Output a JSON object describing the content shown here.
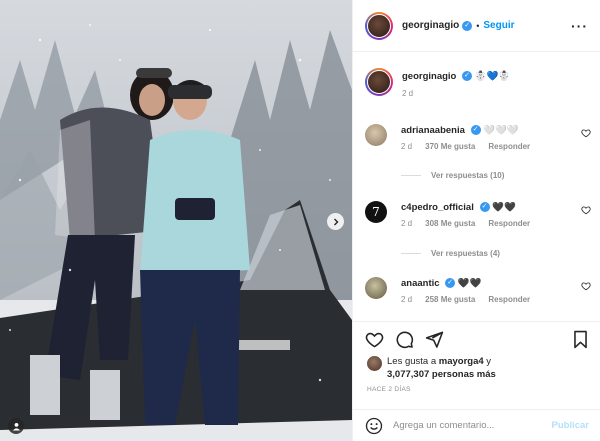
{
  "post": {
    "author": "georginagio",
    "follow_label": "Seguir",
    "separator": "•",
    "more_glyph": "···"
  },
  "caption": {
    "username": "georginagio",
    "text": "☃️💙☃️",
    "time": "2 d"
  },
  "comments": [
    {
      "username": "adrianaabenia",
      "text": "🤍🤍🤍",
      "time": "2 d",
      "likes": "370 Me gusta",
      "reply": "Responder",
      "replies": "Ver respuestas (10)",
      "avatar_color": "#b9a58e"
    },
    {
      "username": "c4pedro_official",
      "text": "🖤🖤",
      "time": "2 d",
      "likes": "308 Me gusta",
      "reply": "Responder",
      "replies": "Ver respuestas (4)",
      "avatar_color": "#111111"
    },
    {
      "username": "anaantic",
      "text": "🖤🖤",
      "time": "2 d",
      "likes": "258 Me gusta",
      "reply": "Responder",
      "avatar_color": "#9a8f6a"
    }
  ],
  "likes": {
    "prefix": "Les gusta a",
    "user": "mayorga4",
    "connector": "y",
    "count": "3,077,307 personas más"
  },
  "timestamp": "HACE 2 DÍAS",
  "add_comment": {
    "placeholder": "Agrega un comentario...",
    "publish_label": "Publicar"
  },
  "colors": {
    "accent": "#0095f6",
    "verified": "#3897f0",
    "muted": "#8e8e8e",
    "publish_disabled": "#b2dffc"
  },
  "icons": [
    "heart-icon",
    "comment-icon",
    "share-icon",
    "bookmark-icon",
    "emoji-icon",
    "next-arrow-icon",
    "user-tag-icon",
    "verified-icon"
  ]
}
